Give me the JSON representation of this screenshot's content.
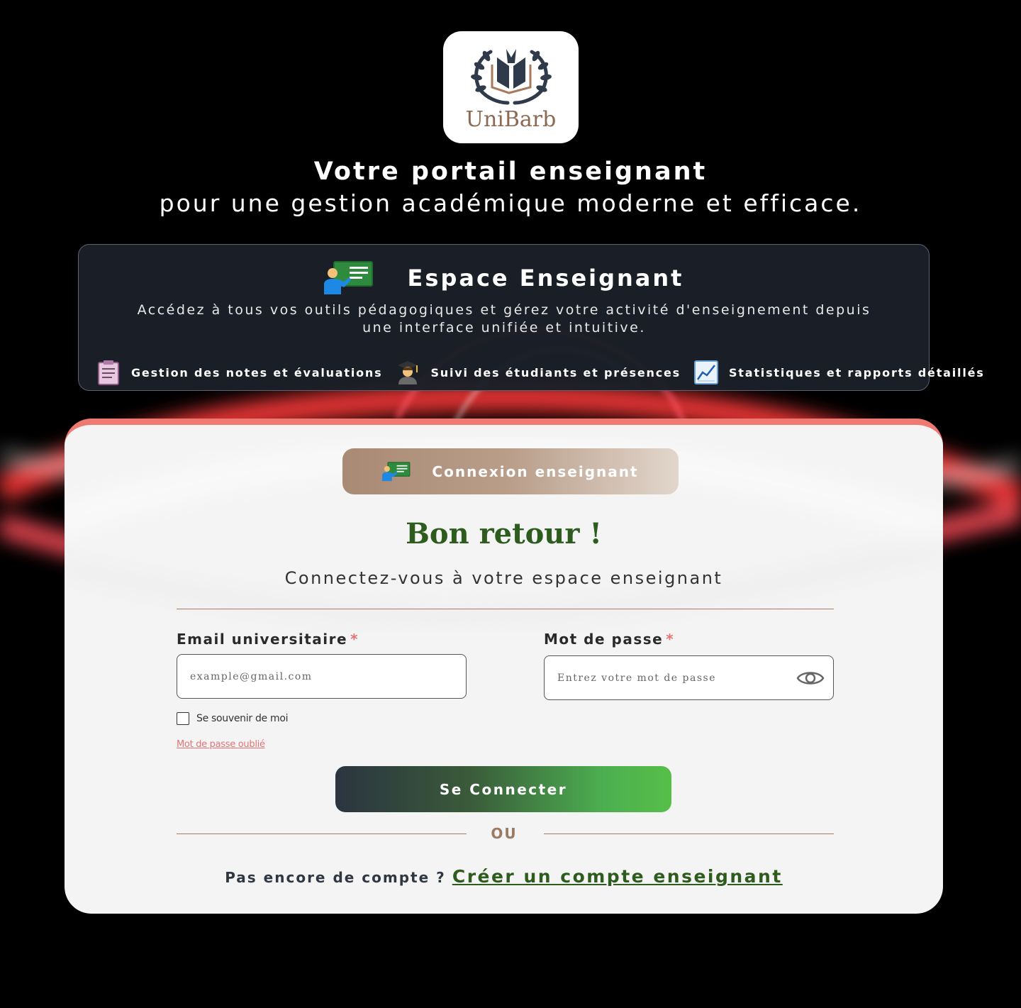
{
  "brand": {
    "logo_text": "UniBarb",
    "accent": "#8a6a52"
  },
  "hero": {
    "title": "Votre portail enseignant",
    "subtitle": "pour une gestion académique moderne et efficace."
  },
  "info_card": {
    "icon": "teacher-board-icon",
    "title": "Espace Enseignant",
    "description": "Accédez à tous vos outils pédagogiques et gérez votre activité d'enseignement depuis une interface unifiée et intuitive.",
    "features": [
      {
        "icon": "clipboard-icon",
        "label": "Gestion des notes et évaluations"
      },
      {
        "icon": "student-icon",
        "label": "Suivi des étudiants et présences"
      },
      {
        "icon": "chart-icon",
        "label": "Statistiques et rapports détaillés"
      }
    ]
  },
  "login": {
    "badge": "Connexion enseignant",
    "heading": "Bon retour !",
    "subheading": "Connectez-vous à votre espace enseignant",
    "email_label": "Email universitaire",
    "email_placeholder": "example@gmail.com",
    "password_label": "Mot de passe",
    "password_placeholder": "Entrez votre mot de passe",
    "required_mark": "*",
    "remember_label": "Se souvenir de moi",
    "remember_checked": false,
    "forgot_label": "Mot de passe oublié",
    "submit_label": "Se Connecter",
    "or_label": "OU",
    "signup_question": "Pas encore de compte ?",
    "signup_link": "Créer un compte enseignant"
  },
  "colors": {
    "card_top_border": "#ef7a72",
    "heading_green": "#2e5b1e",
    "required_red": "#e57373",
    "divider": "#a87a62"
  }
}
